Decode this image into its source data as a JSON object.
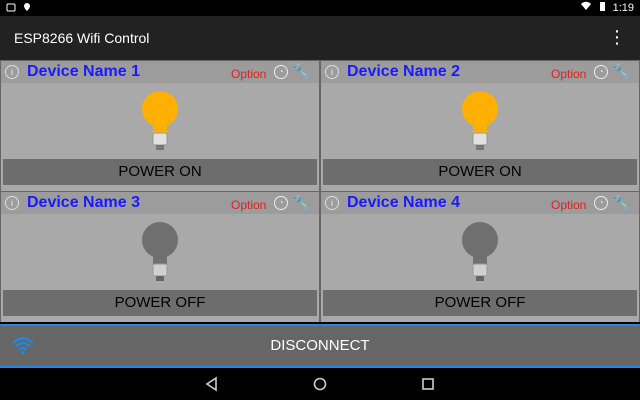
{
  "status_bar": {
    "time": "1:19"
  },
  "app_bar": {
    "title": "ESP8266 Wifi Control",
    "menu_icon": "more-vertical-icon"
  },
  "devices": [
    {
      "name": "Device Name 1",
      "option_label": "Option",
      "power_label": "POWER ON",
      "state": "on"
    },
    {
      "name": "Device Name 2",
      "option_label": "Option",
      "power_label": "POWER ON",
      "state": "on"
    },
    {
      "name": "Device Name 3",
      "option_label": "Option",
      "power_label": "POWER OFF",
      "state": "off"
    },
    {
      "name": "Device Name 4",
      "option_label": "Option",
      "power_label": "POWER OFF",
      "state": "off"
    }
  ],
  "footer": {
    "disconnect_label": "DISCONNECT"
  },
  "colors": {
    "device_name": "#1a1aff",
    "option_text": "#e02020",
    "accent": "#1e88e5",
    "bulb_on": "#ffb000",
    "bulb_off": "#6f6f6f"
  }
}
